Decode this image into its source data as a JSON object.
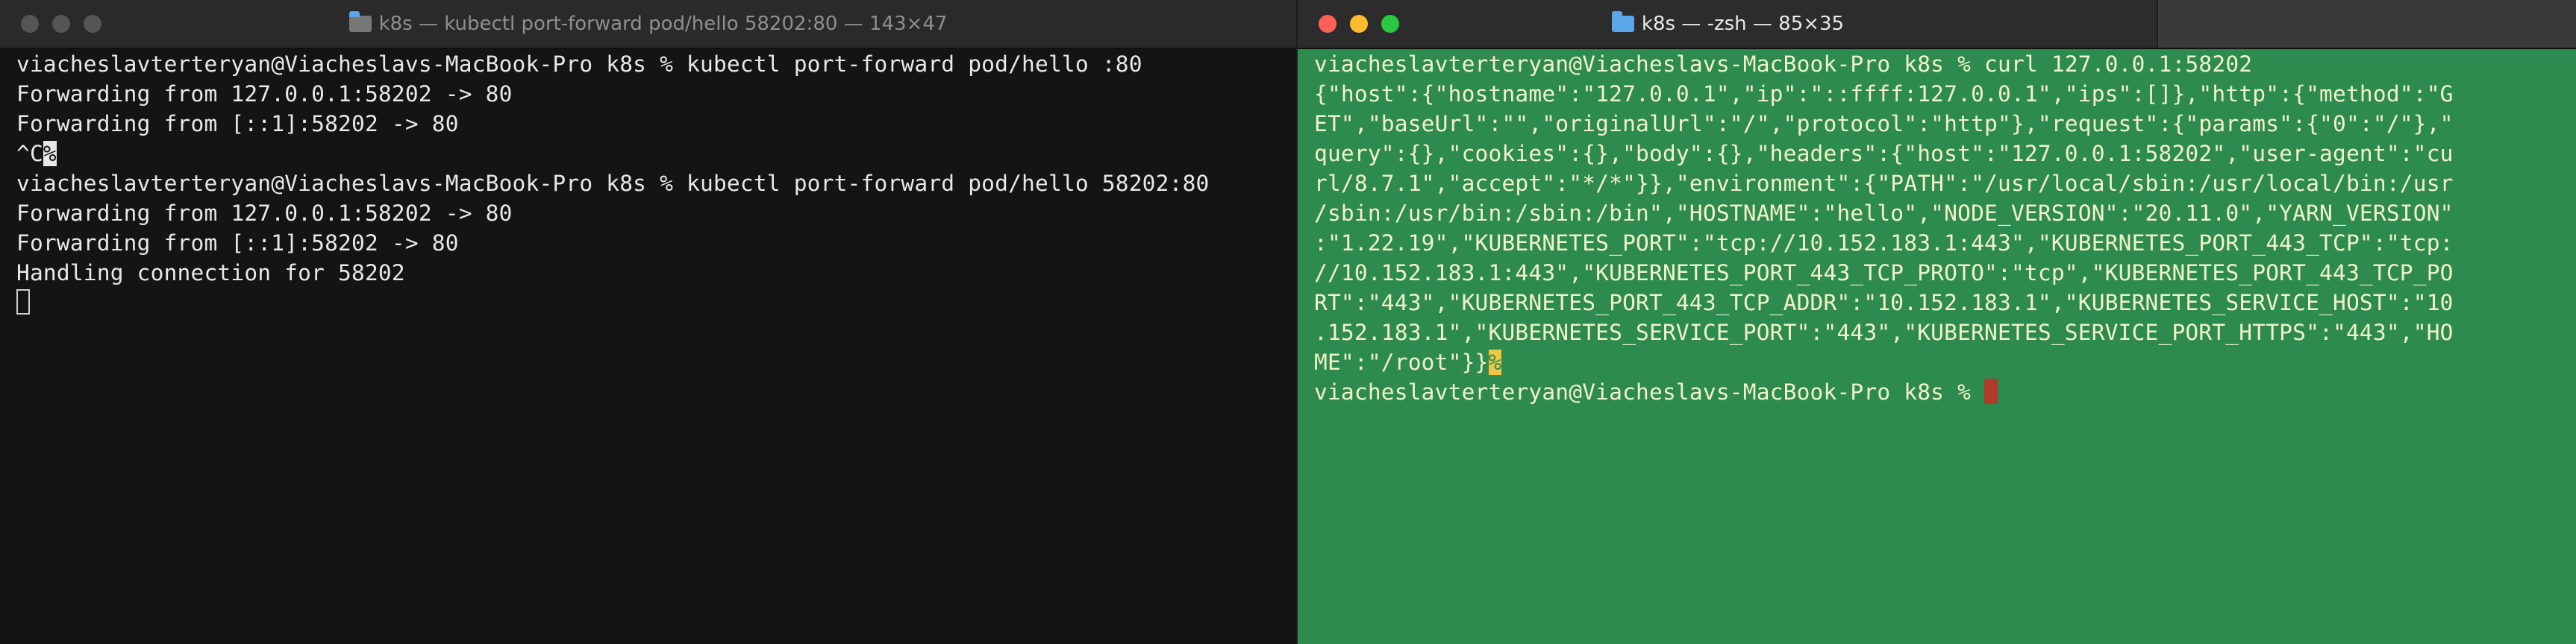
{
  "left_window": {
    "title": "k8s — kubectl port-forward pod/hello 58202:80 — 143×47",
    "lines": [
      "viacheslavterteryan@Viacheslavs-MacBook-Pro k8s % kubectl port-forward pod/hello :80",
      "Forwarding from 127.0.0.1:58202 -> 80",
      "Forwarding from [::1]:58202 -> 80",
      "^C",
      "viacheslavterteryan@Viacheslavs-MacBook-Pro k8s % kubectl port-forward pod/hello 58202:80",
      "Forwarding from 127.0.0.1:58202 -> 80",
      "Forwarding from [::1]:58202 -> 80",
      "Handling connection for 58202"
    ],
    "percent_marker": "%"
  },
  "right_window": {
    "title": "k8s — -zsh — 85×35",
    "lines": [
      "viacheslavterteryan@Viacheslavs-MacBook-Pro k8s % curl 127.0.0.1:58202",
      "{\"host\":{\"hostname\":\"127.0.0.1\",\"ip\":\"::ffff:127.0.0.1\",\"ips\":[]},\"http\":{\"method\":\"G",
      "ET\",\"baseUrl\":\"\",\"originalUrl\":\"/\",\"protocol\":\"http\"},\"request\":{\"params\":{\"0\":\"/\"},\"",
      "query\":{},\"cookies\":{},\"body\":{},\"headers\":{\"host\":\"127.0.0.1:58202\",\"user-agent\":\"cu",
      "rl/8.7.1\",\"accept\":\"*/*\"}},\"environment\":{\"PATH\":\"/usr/local/sbin:/usr/local/bin:/usr",
      "/sbin:/usr/bin:/sbin:/bin\",\"HOSTNAME\":\"hello\",\"NODE_VERSION\":\"20.11.0\",\"YARN_VERSION\"",
      ":\"1.22.19\",\"KUBERNETES_PORT\":\"tcp://10.152.183.1:443\",\"KUBERNETES_PORT_443_TCP\":\"tcp:",
      "//10.152.183.1:443\",\"KUBERNETES_PORT_443_TCP_PROTO\":\"tcp\",\"KUBERNETES_PORT_443_TCP_PO",
      "RT\":\"443\",\"KUBERNETES_PORT_443_TCP_ADDR\":\"10.152.183.1\",\"KUBERNETES_SERVICE_HOST\":\"10",
      ".152.183.1\",\"KUBERNETES_SERVICE_PORT\":\"443\",\"KUBERNETES_SERVICE_PORT_HTTPS\":\"443\",\"HO",
      "ME\":\"/root\"}}",
      "viacheslavterteryan@Viacheslavs-MacBook-Pro k8s % "
    ],
    "percent_marker": "%"
  },
  "colors": {
    "left_bg": "#141414",
    "right_bg": "#2e8b4f",
    "close": "#ff5f57",
    "minimize": "#febc2e",
    "zoom": "#28c840"
  }
}
